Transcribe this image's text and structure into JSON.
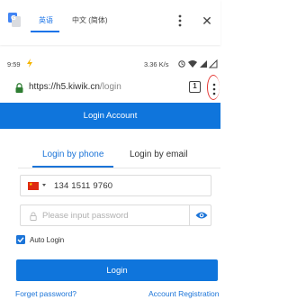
{
  "translate_bar": {
    "source_language": "英语",
    "target_language": "中文 (简体)",
    "icons": {
      "logo": "google-translate-icon",
      "menu": "more-vert-icon",
      "close": "close-icon"
    }
  },
  "status_bar": {
    "time": "9:59",
    "network_speed": "3.36 K/s"
  },
  "url_bar": {
    "host": "https://h5.kiwik.cn",
    "path": "/login",
    "tab_count": "1"
  },
  "header": {
    "title": "Login Account"
  },
  "login_tabs": {
    "phone": "Login by phone",
    "email": "Login by email",
    "active": "phone"
  },
  "phone_field": {
    "country_flag": "china-flag-icon",
    "value": "134 1511 9760"
  },
  "password_field": {
    "placeholder": "Please input password",
    "value": ""
  },
  "auto_login": {
    "label": "Auto Login",
    "checked": true
  },
  "login_button": {
    "label": "Login"
  },
  "footer": {
    "forgot_password": "Forget password?",
    "register": "Account Registration"
  },
  "colors": {
    "accent": "#0f75dc",
    "link": "#1b74d8",
    "highlight_ring": "#e53935",
    "flag_red": "#de2910"
  }
}
